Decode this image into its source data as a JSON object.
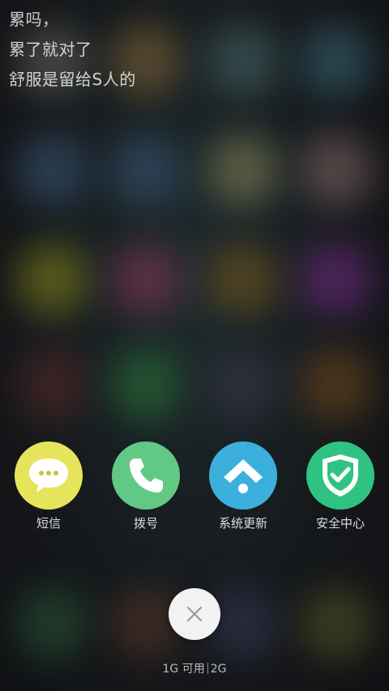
{
  "motto": {
    "line1": "累吗，",
    "line2": "累了就对了",
    "line3": "舒服是留给S人的"
  },
  "shortcuts": [
    {
      "label": "短信",
      "icon": "message-bubble-icon",
      "color": "#e6e45a"
    },
    {
      "label": "拨号",
      "icon": "phone-icon",
      "color": "#62c984"
    },
    {
      "label": "系统更新",
      "icon": "system-update-icon",
      "color": "#3bb0dc"
    },
    {
      "label": "安全中心",
      "icon": "shield-check-icon",
      "color": "#2fc381"
    }
  ],
  "close_button": {
    "icon": "close-icon"
  },
  "memory": {
    "available": "1G 可用",
    "total": "2G"
  }
}
